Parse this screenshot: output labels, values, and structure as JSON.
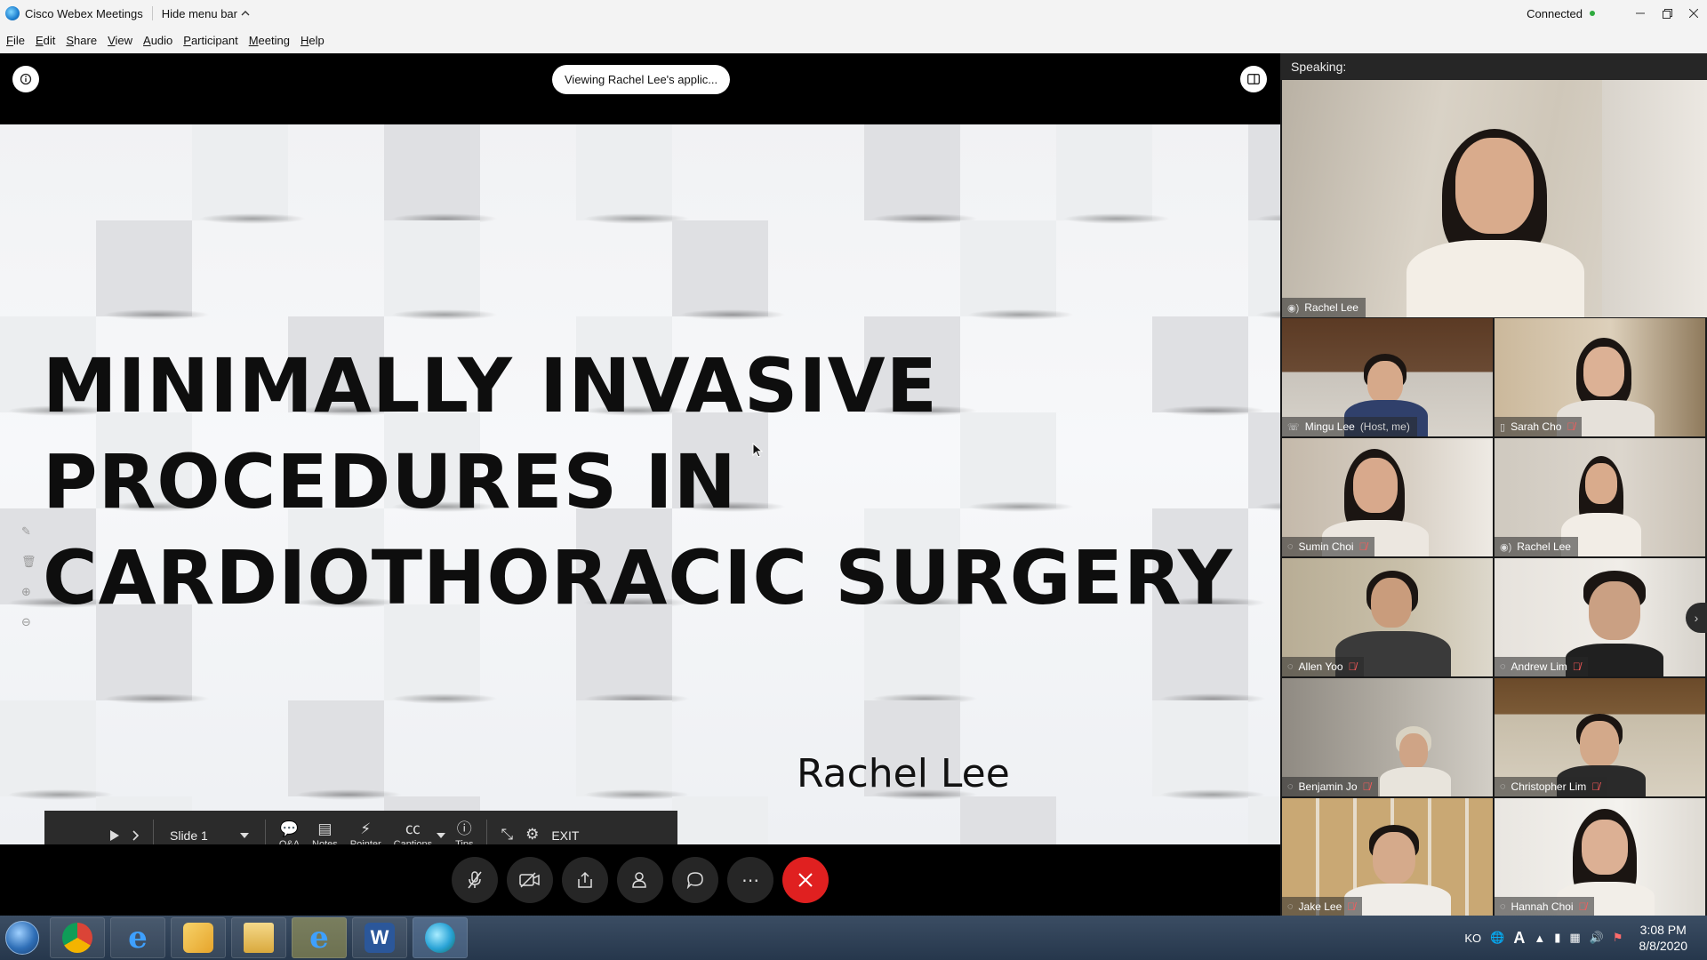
{
  "titlebar": {
    "app_title": "Cisco Webex Meetings",
    "hide_menu": "Hide menu bar",
    "hide_menu_icon": "chevron-up-icon",
    "status": "Connected",
    "status_color": "#2eaa3e"
  },
  "menu": [
    "File",
    "Edit",
    "Share",
    "View",
    "Audio",
    "Participant",
    "Meeting",
    "Help"
  ],
  "stage": {
    "viewing_text": "Viewing Rachel Lee's applic...",
    "slide_title_lines": [
      "MINIMALLY INVASIVE",
      "PROCEDURES IN",
      "CARDIOTHORACIC SURGERY"
    ],
    "slide_author": "Rachel Lee"
  },
  "presenter_toolbar": {
    "slide_label": "Slide 1",
    "buttons": {
      "qa": "Q&A",
      "notes": "Notes",
      "pointer": "Pointer",
      "captions": "Captions",
      "tips": "Tips",
      "exit": "EXIT"
    }
  },
  "panel": {
    "speaking_label": "Speaking:",
    "active_speaker": "Rachel Lee",
    "participants": [
      {
        "name": "Mingu Lee",
        "tag": "(Host, me)",
        "muted": false,
        "status_icon": "phone-icon"
      },
      {
        "name": "Sarah Cho",
        "tag": "",
        "muted": true,
        "status_icon": "device-icon"
      },
      {
        "name": "Sumin Choi",
        "tag": "",
        "muted": true,
        "status_icon": "audio-icon"
      },
      {
        "name": "Rachel Lee",
        "tag": "",
        "muted": false,
        "status_icon": "speaking-icon"
      },
      {
        "name": "Allen Yoo",
        "tag": "",
        "muted": true,
        "status_icon": "audio-icon"
      },
      {
        "name": "Andrew Lim",
        "tag": "",
        "muted": true,
        "status_icon": "audio-icon"
      },
      {
        "name": "Benjamin Jo",
        "tag": "",
        "muted": true,
        "status_icon": "audio-icon"
      },
      {
        "name": "Christopher Lim",
        "tag": "",
        "muted": true,
        "status_icon": "audio-icon"
      },
      {
        "name": "Jake Lee",
        "tag": "",
        "muted": true,
        "status_icon": "audio-icon"
      },
      {
        "name": "Hannah Choi",
        "tag": "",
        "muted": true,
        "status_icon": "audio-icon"
      }
    ]
  },
  "taskbar": {
    "apps": [
      "chrome-icon",
      "internet-explorer-icon",
      "outlook-icon",
      "file-explorer-icon",
      "internet-explorer-icon",
      "word-icon",
      "webex-icon"
    ],
    "language": "KO",
    "time": "3:08 PM",
    "date": "8/8/2020"
  }
}
